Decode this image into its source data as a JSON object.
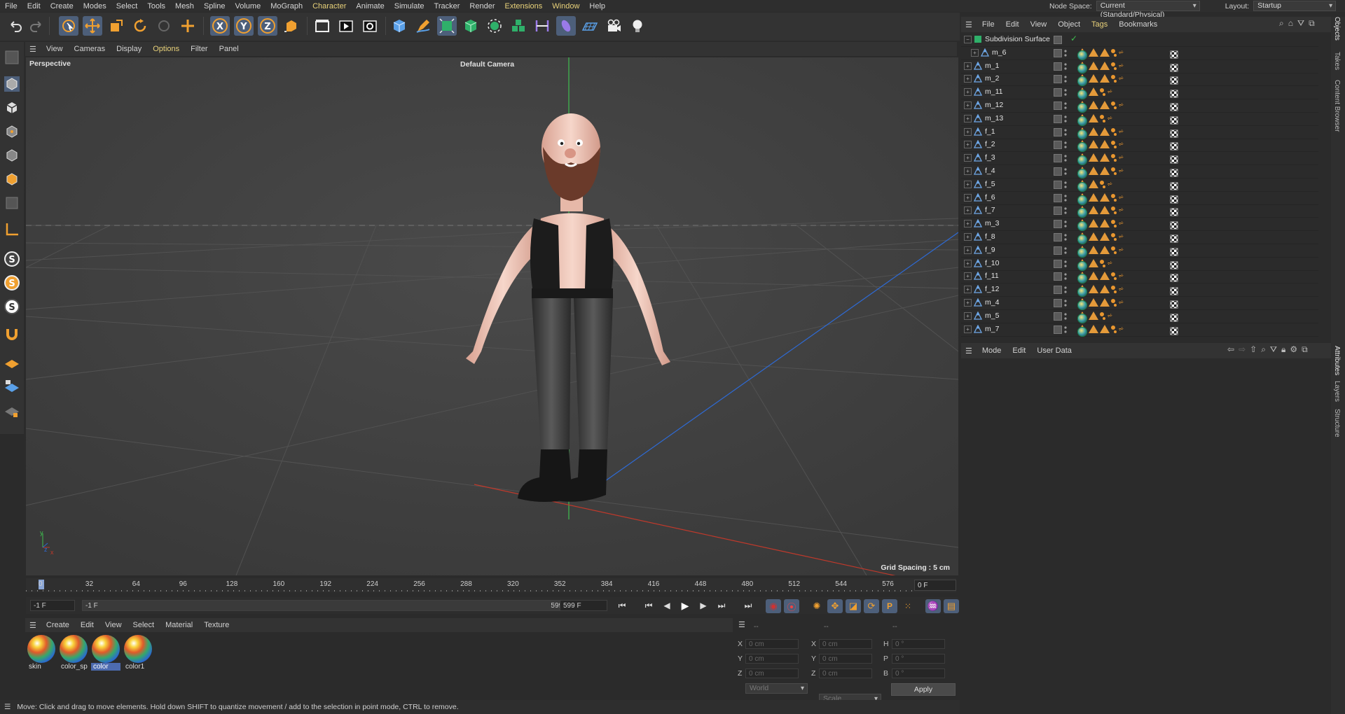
{
  "menubar": {
    "items": [
      "File",
      "Edit",
      "Create",
      "Modes",
      "Select",
      "Tools",
      "Mesh",
      "Spline",
      "Volume",
      "MoGraph",
      "Character",
      "Animate",
      "Simulate",
      "Tracker",
      "Render",
      "Extensions",
      "Window",
      "Help"
    ],
    "node_space_label": "Node Space:",
    "node_space_value": "Current (Standard/Physical)",
    "layout_label": "Layout:",
    "layout_value": "Startup"
  },
  "viewport": {
    "menu": [
      "View",
      "Cameras",
      "Display",
      "Options",
      "Filter",
      "Panel"
    ],
    "label": "Perspective",
    "camera": "Default Camera",
    "grid_spacing": "Grid Spacing : 5 cm",
    "axis_y": "y",
    "axis_x": "x",
    "axis_z": "z"
  },
  "timeline": {
    "ticks": [
      "0",
      "32",
      "64",
      "96",
      "128",
      "160",
      "192",
      "224",
      "256",
      "288",
      "320",
      "352",
      "384",
      "416",
      "448",
      "480",
      "512",
      "544",
      "576"
    ],
    "current_frame": "0 F",
    "start_field": "-1 F",
    "range_start": "-1 F",
    "range_end": "599 F",
    "end_field": "599 F"
  },
  "materials": {
    "menu": [
      "Create",
      "Edit",
      "View",
      "Select",
      "Material",
      "Texture"
    ],
    "items": [
      {
        "name": "skin",
        "selected": false
      },
      {
        "name": "color_sp",
        "selected": false
      },
      {
        "name": "color",
        "selected": true
      },
      {
        "name": "color1",
        "selected": false
      }
    ]
  },
  "coordinates": {
    "header": [
      "--",
      "--",
      "--"
    ],
    "rows": [
      {
        "a": "X",
        "av": "0 cm",
        "b": "X",
        "bv": "0 cm",
        "c": "H",
        "cv": "0 °"
      },
      {
        "a": "Y",
        "av": "0 cm",
        "b": "Y",
        "bv": "0 cm",
        "c": "P",
        "cv": "0 °"
      },
      {
        "a": "Z",
        "av": "0 cm",
        "b": "Z",
        "bv": "0 cm",
        "c": "B",
        "cv": "0 °"
      }
    ],
    "mode_world": "World",
    "mode_scale": "Scale",
    "apply": "Apply"
  },
  "status": "Move: Click and drag to move elements. Hold down SHIFT to quantize movement / add to the selection in point mode, CTRL to remove.",
  "objects": {
    "menu": [
      "File",
      "Edit",
      "View",
      "Object",
      "Tags",
      "Bookmarks"
    ],
    "root": "Subdivision Surface",
    "rows": [
      {
        "name": "m_6",
        "tags": "long"
      },
      {
        "name": "m_1",
        "tags": "long"
      },
      {
        "name": "m_2",
        "tags": "long"
      },
      {
        "name": "m_11",
        "tags": "short"
      },
      {
        "name": "m_12",
        "tags": "long"
      },
      {
        "name": "m_13",
        "tags": "short"
      },
      {
        "name": "f_1",
        "tags": "xl"
      },
      {
        "name": "f_2",
        "tags": "long"
      },
      {
        "name": "f_3",
        "tags": "long"
      },
      {
        "name": "f_4",
        "tags": "long"
      },
      {
        "name": "f_5",
        "tags": "short"
      },
      {
        "name": "f_6",
        "tags": "long"
      },
      {
        "name": "f_7",
        "tags": "long"
      },
      {
        "name": "m_3",
        "tags": "long"
      },
      {
        "name": "f_8",
        "tags": "xl"
      },
      {
        "name": "f_9",
        "tags": "xl"
      },
      {
        "name": "f_10",
        "tags": "short"
      },
      {
        "name": "f_11",
        "tags": "long"
      },
      {
        "name": "f_12",
        "tags": "xl"
      },
      {
        "name": "m_4",
        "tags": "xl"
      },
      {
        "name": "m_5",
        "tags": "short"
      },
      {
        "name": "m_7",
        "tags": "long"
      }
    ]
  },
  "attributes": {
    "menu": [
      "Mode",
      "Edit",
      "User Data"
    ]
  },
  "side_tabs": [
    "Objects",
    "Takes",
    "Content Browser",
    "Attributes",
    "Layers",
    "Structure"
  ],
  "colors": {
    "accent_yellow": "#e9d27a",
    "selection_blue": "#4d6bb0",
    "tag_orange": "#e49a3a"
  }
}
